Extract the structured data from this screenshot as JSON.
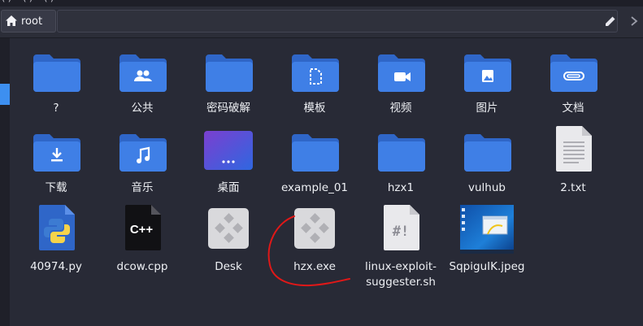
{
  "top_strip": {
    "text": "(·) · ·(·) · ·(·)"
  },
  "breadcrumb": {
    "home_label": "root"
  },
  "folders_row1": [
    {
      "name": "?",
      "glyph": "none"
    },
    {
      "name": "公共",
      "glyph": "people"
    },
    {
      "name": "密码破解",
      "glyph": "none"
    },
    {
      "name": "模板",
      "glyph": "template"
    },
    {
      "name": "视频",
      "glyph": "video"
    },
    {
      "name": "图片",
      "glyph": "image"
    },
    {
      "name": "文档",
      "glyph": "clip"
    }
  ],
  "folders_row2": [
    {
      "name": "下载",
      "glyph": "download"
    },
    {
      "name": "音乐",
      "glyph": "music"
    },
    {
      "name": "桌面",
      "glyph": "desktop"
    },
    {
      "name": "example_01",
      "glyph": "none"
    },
    {
      "name": "hzx1",
      "glyph": "none"
    },
    {
      "name": "vulhub",
      "glyph": "none"
    },
    {
      "name": "2.txt",
      "glyph": "text"
    }
  ],
  "files_row3": [
    {
      "name": "40974.py",
      "glyph": "python"
    },
    {
      "name": "dcow.cpp",
      "glyph": "cpp"
    },
    {
      "name": "Desk",
      "glyph": "exe"
    },
    {
      "name": "hzx.exe",
      "glyph": "exe"
    },
    {
      "name": "linux-exploit-\nsuggester.sh",
      "glyph": "shell"
    },
    {
      "name": "SqpiguIK.jpeg",
      "glyph": "jpeg"
    }
  ],
  "colors": {
    "folder": "#3f7fe6",
    "folder_tab": "#2f66c8",
    "accent": "#3d8ff0",
    "annotation": "#e01818"
  },
  "icons": {
    "home": "home-icon",
    "edit": "pencil-icon",
    "more": "chevron-right-icon"
  }
}
